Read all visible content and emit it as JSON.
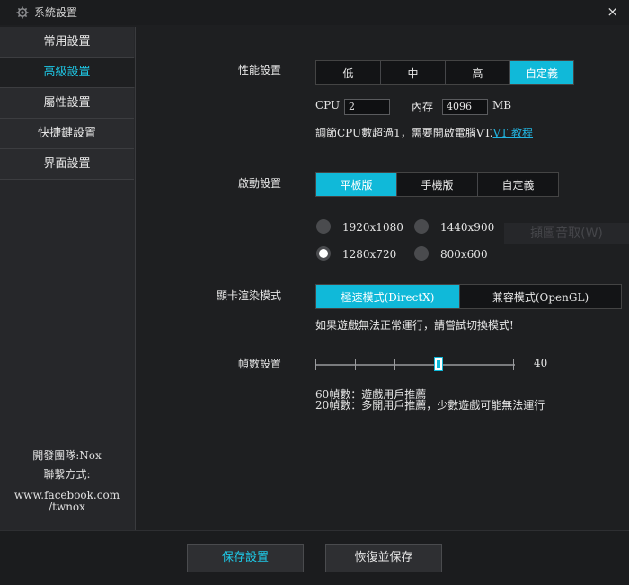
{
  "window": {
    "title": "系統設置",
    "close_label": "×"
  },
  "sidebar": {
    "items": [
      {
        "label": "常用設置"
      },
      {
        "label": "高級設置",
        "active": true
      },
      {
        "label": "屬性設置"
      },
      {
        "label": "快捷鍵設置"
      },
      {
        "label": "界面設置"
      }
    ],
    "team": "開發團隊:Nox",
    "contact_label": "聯繫方式:",
    "url_line1": "www.facebook.com",
    "url_line2": "/twnox"
  },
  "performance": {
    "label": "性能設置",
    "options": [
      "低",
      "中",
      "高",
      "自定義"
    ],
    "selected": "自定義",
    "cpu_label": "CPU",
    "cpu_value": "2",
    "memory_label": "內存",
    "memory_value": "4096",
    "memory_unit": "MB",
    "vt_note": "調節CPU數超過1，需要開啟電腦VT.",
    "vt_link": "VT 教程"
  },
  "startup": {
    "label": "啟動設置",
    "options": [
      "平板版",
      "手機版",
      "自定義"
    ],
    "selected": "平板版",
    "resolutions": [
      "1920x1080",
      "1440x900",
      "1280x720",
      "800x600"
    ],
    "selected_resolution": "1280x720",
    "ghost_text": "擷圖音取(W)"
  },
  "render": {
    "label": "顯卡渲染模式",
    "options": [
      "極速模式(DirectX)",
      "兼容模式(OpenGL)"
    ],
    "selected": "極速模式(DirectX)",
    "note": "如果遊戲無法正常運行，請嘗試切換模式!"
  },
  "fps": {
    "label": "幀數設置",
    "value": "40",
    "slider_fraction": 0.625,
    "note1": "60幀數：遊戲用戶推薦",
    "note2": "20幀數：多開用戶推薦，少數遊戲可能無法運行"
  },
  "footer": {
    "save": "保存設置",
    "restore": "恢復並保存"
  },
  "colors": {
    "accent": "#10b9d9",
    "link": "#22b4e0",
    "background": "#1e1f21"
  }
}
